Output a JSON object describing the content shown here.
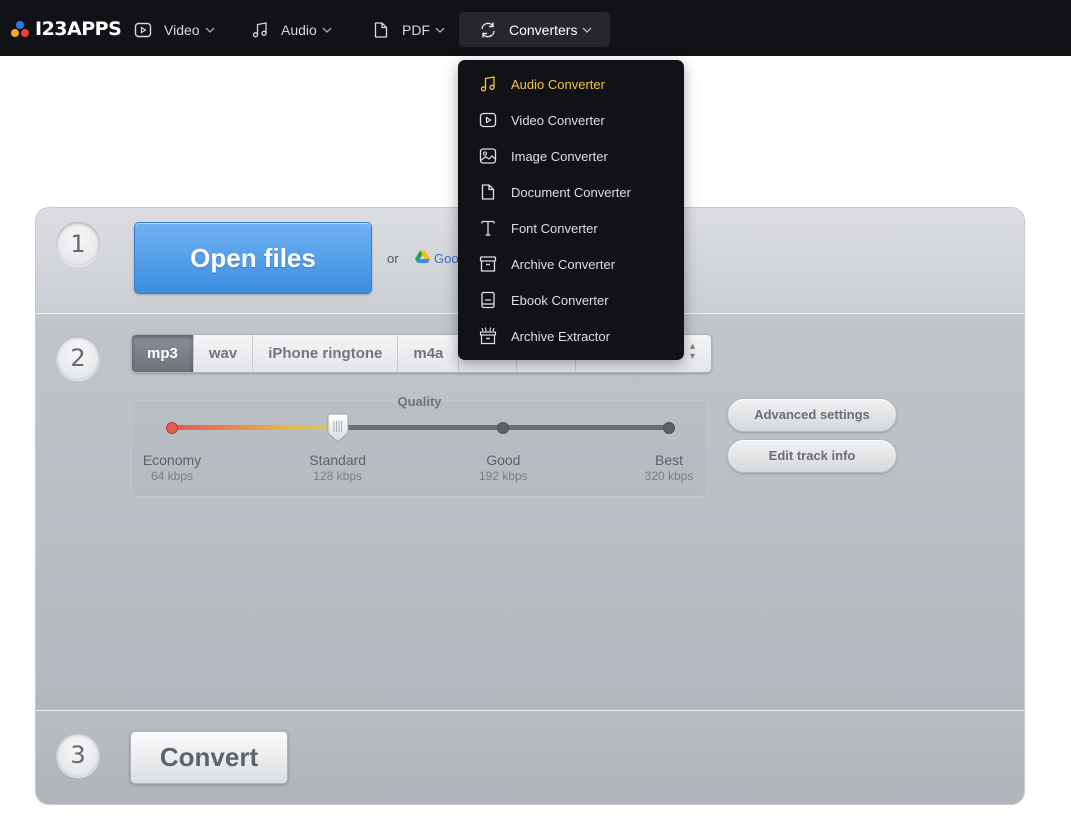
{
  "brand": {
    "name": "I23APPS"
  },
  "nav": {
    "items": [
      {
        "label": "Video",
        "icon": "play-square-icon"
      },
      {
        "label": "Audio",
        "icon": "music-note-icon"
      },
      {
        "label": "PDF",
        "icon": "document-icon"
      },
      {
        "label": "Converters",
        "icon": "convert-arrows-icon",
        "active": true
      }
    ]
  },
  "dropdown": {
    "items": [
      {
        "label": "Audio Converter",
        "icon": "music-note-icon",
        "active": true
      },
      {
        "label": "Video Converter",
        "icon": "play-square-icon"
      },
      {
        "label": "Image Converter",
        "icon": "image-icon"
      },
      {
        "label": "Document Converter",
        "icon": "document-icon"
      },
      {
        "label": "Font Converter",
        "icon": "font-icon"
      },
      {
        "label": "Archive Converter",
        "icon": "archive-box-icon"
      },
      {
        "label": "Ebook Converter",
        "icon": "ebook-icon"
      },
      {
        "label": "Archive Extractor",
        "icon": "archive-extract-icon"
      }
    ]
  },
  "step1": {
    "number": "1",
    "open_label": "Open files",
    "or_label": "or",
    "drive_label": "Goo"
  },
  "step2": {
    "number": "2",
    "formats": [
      "mp3",
      "wav",
      "iPhone ringtone",
      "m4a"
    ],
    "selected_format": "mp3",
    "quality": {
      "title": "Quality",
      "selected_index": 1,
      "levels": [
        {
          "name": "Economy",
          "kbps": "64 kbps"
        },
        {
          "name": "Standard",
          "kbps": "128 kbps"
        },
        {
          "name": "Good",
          "kbps": "192 kbps"
        },
        {
          "name": "Best",
          "kbps": "320 kbps"
        }
      ]
    },
    "advanced_label": "Advanced settings",
    "edit_track_label": "Edit track info"
  },
  "step3": {
    "number": "3",
    "convert_label": "Convert"
  },
  "colors": {
    "accent_active": "#f3c244",
    "open_button": "#4a9ae6",
    "nav_bg": "#111216"
  }
}
